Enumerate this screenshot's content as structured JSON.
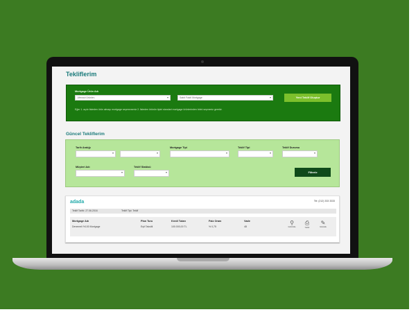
{
  "page": {
    "title": "Tekliflerim"
  },
  "new_offer": {
    "label": "Mortgage Ürün Adı",
    "select1": "-Mevcut Ürünler-",
    "select2": "Sabit Faizli Mortgage",
    "button": "Yeni Teklif Oluştur",
    "hint": "Eğer 1. açılır listeden ürün almayı mortgage seçmezseniz 2. listeden ürünün tipini standart mortgage ürünlerinden birini seçmeniz gerekir."
  },
  "current": {
    "title": "Güncel Tekliflerim"
  },
  "filters": {
    "date_range": "Tarih Aralığı",
    "mortgage_type": "Mortgage Tipi",
    "offer_type": "Teklif Tipi",
    "offer_state": "Teklif Durumu",
    "customer": "Müşteri Adı",
    "offer_status": "Teklif Statüsü",
    "button": "Filtrele"
  },
  "offer": {
    "name": "adada",
    "phone": "Tel: (212) 333 3333",
    "date": "Teklif Tarihi: 27.06.2016",
    "type": "Teklif Tipi: Teklif",
    "headers": [
      "Mortgage Adı",
      "Plan Turu",
      "Kredi Tutarı",
      "Faiz Oranı",
      "Vade"
    ],
    "row": [
      "Denemeli %100 Mortgage",
      "Eşit Taksitli",
      "100.000,00 TL",
      "% 0,75",
      "48"
    ],
    "actions": [
      {
        "icon": "search-icon",
        "label": "Görüntüle"
      },
      {
        "icon": "print-icon",
        "label": "Yazdır"
      },
      {
        "icon": "edit-icon",
        "label": "Güncelle"
      }
    ]
  },
  "colors": {
    "background": "#3c7b22",
    "primary": "#1b7a10",
    "light": "#b6e69a",
    "accent": "#7cc02c",
    "dark_button": "#0f4a1a",
    "title": "#1a7a7a"
  }
}
